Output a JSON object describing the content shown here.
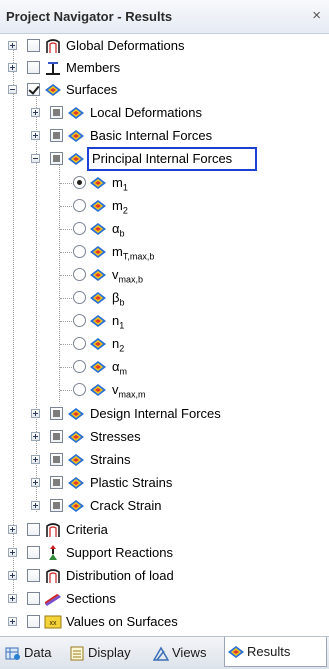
{
  "window": {
    "title": "Project Navigator - Results",
    "close_glyph": "×"
  },
  "tree": [
    {
      "label": "Global Deformations",
      "icon": "deformation-icon",
      "expander": "plus",
      "check": "none"
    },
    {
      "label": "Members",
      "icon": "member-icon",
      "expander": "plus",
      "check": "none"
    },
    {
      "label": "Surfaces",
      "icon": "surface-icon",
      "expander": "minus",
      "check": "checked"
    },
    {
      "label": "Local Deformations",
      "icon": "surface-icon",
      "expander": "plus",
      "check": "partial"
    },
    {
      "label": "Basic Internal Forces",
      "icon": "surface-icon",
      "expander": "plus",
      "check": "partial"
    },
    {
      "label": "Principal Internal Forces",
      "icon": "surface-icon",
      "expander": "minus",
      "check": "partial"
    },
    {
      "label": "m1",
      "icon": "surface-icon",
      "radio": "on"
    },
    {
      "label": "m2",
      "icon": "surface-icon",
      "radio": "off"
    },
    {
      "label": "αb",
      "icon": "surface-icon",
      "radio": "off"
    },
    {
      "label": "mT,max,b",
      "icon": "surface-icon",
      "radio": "off"
    },
    {
      "label": "vmax,b",
      "icon": "surface-icon",
      "radio": "off"
    },
    {
      "label": "βb",
      "icon": "surface-icon",
      "radio": "off"
    },
    {
      "label": "n1",
      "icon": "surface-icon",
      "radio": "off"
    },
    {
      "label": "n2",
      "icon": "surface-icon",
      "radio": "off"
    },
    {
      "label": "αm",
      "icon": "surface-icon",
      "radio": "off"
    },
    {
      "label": "vmax,m",
      "icon": "surface-icon",
      "radio": "off"
    },
    {
      "label": "Design Internal Forces",
      "icon": "surface-icon",
      "expander": "plus",
      "check": "partial"
    },
    {
      "label": "Stresses",
      "icon": "surface-icon",
      "expander": "plus",
      "check": "partial"
    },
    {
      "label": "Strains",
      "icon": "surface-icon",
      "expander": "plus",
      "check": "partial"
    },
    {
      "label": "Plastic Strains",
      "icon": "surface-icon",
      "expander": "plus",
      "check": "partial"
    },
    {
      "label": "Crack Strain",
      "icon": "surface-icon",
      "expander": "plus",
      "check": "partial"
    },
    {
      "label": "Criteria",
      "icon": "deformation-icon",
      "expander": "plus",
      "check": "none"
    },
    {
      "label": "Support Reactions",
      "icon": "support-icon",
      "expander": "plus",
      "check": "none"
    },
    {
      "label": "Distribution of load",
      "icon": "deformation-icon",
      "expander": "plus",
      "check": "none"
    },
    {
      "label": "Sections",
      "icon": "section-icon",
      "expander": "plus",
      "check": "none"
    },
    {
      "label": "Values on Surfaces",
      "icon": "values-icon",
      "expander": "plus",
      "check": "none"
    }
  ],
  "radio_labels": {
    "m1": {
      "base": "m",
      "sub": "1"
    },
    "m2": {
      "base": "m",
      "sub": "2"
    },
    "ab": {
      "base": "α",
      "sub": "b"
    },
    "mt": {
      "base": "m",
      "sub": "T,max,b"
    },
    "vb": {
      "base": "v",
      "sub": "max,b"
    },
    "bb": {
      "base": "β",
      "sub": "b"
    },
    "n1": {
      "base": "n",
      "sub": "1"
    },
    "n2": {
      "base": "n",
      "sub": "2"
    },
    "am": {
      "base": "α",
      "sub": "m"
    },
    "vm": {
      "base": "v",
      "sub": "max,m"
    }
  },
  "tabs": [
    {
      "label": "Data",
      "icon": "data-icon",
      "active": false
    },
    {
      "label": "Display",
      "icon": "display-icon",
      "active": false
    },
    {
      "label": "Views",
      "icon": "views-icon",
      "active": false
    },
    {
      "label": "Results",
      "icon": "results-icon",
      "active": true
    }
  ]
}
